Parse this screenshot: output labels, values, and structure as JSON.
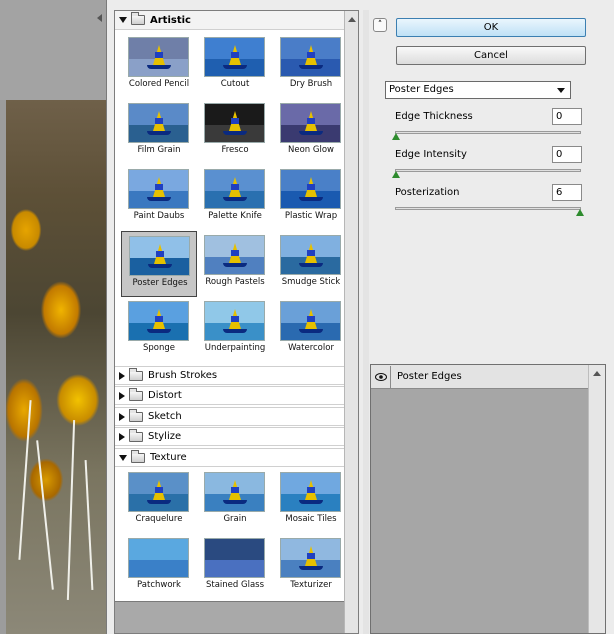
{
  "buttons": {
    "ok": "OK",
    "cancel": "Cancel",
    "collapse_glyph": "˄"
  },
  "filter_select": {
    "value": "Poster Edges"
  },
  "params": [
    {
      "label": "Edge Thickness",
      "value": "0",
      "fraction": 0.0
    },
    {
      "label": "Edge Intensity",
      "value": "0",
      "fraction": 0.0
    },
    {
      "label": "Posterization",
      "value": "6",
      "fraction": 1.0
    }
  ],
  "layer_panel": {
    "layer_name": "Poster Edges",
    "eye_icon": "eye-icon"
  },
  "categories": [
    {
      "name": "Artistic",
      "expanded": true,
      "filters": [
        "Colored Pencil",
        "Cutout",
        "Dry Brush",
        "Film Grain",
        "Fresco",
        "Neon Glow",
        "Paint Daubs",
        "Palette Knife",
        "Plastic Wrap",
        "Poster Edges",
        "Rough Pastels",
        "Smudge Stick",
        "Sponge",
        "Underpainting",
        "Watercolor"
      ],
      "selected": "Poster Edges"
    },
    {
      "name": "Brush Strokes",
      "expanded": false
    },
    {
      "name": "Distort",
      "expanded": false
    },
    {
      "name": "Sketch",
      "expanded": false
    },
    {
      "name": "Stylize",
      "expanded": false
    },
    {
      "name": "Texture",
      "expanded": true,
      "filters": [
        "Craquelure",
        "Grain",
        "Mosaic Tiles",
        "Patchwork",
        "Stained Glass",
        "Texturizer"
      ]
    }
  ],
  "colors": {
    "ok_accent": "#3c7fb1",
    "slider_knob": "#2e8b2e",
    "autumn_yellow": "#f0b400"
  }
}
